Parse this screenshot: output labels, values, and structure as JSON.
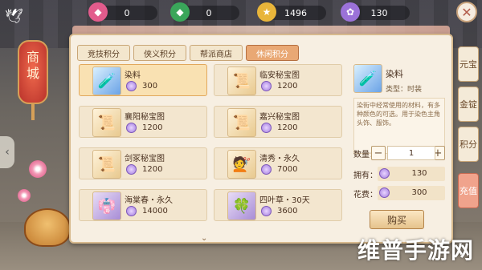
{
  "currencies": [
    {
      "icon": "pink-jade-icon",
      "value": "0",
      "color": "#e25b8c"
    },
    {
      "icon": "green-jade-icon",
      "value": "0",
      "color": "#3aa65a"
    },
    {
      "icon": "gold-coin-icon",
      "value": "1496",
      "color": "#e8b53a"
    },
    {
      "icon": "purple-coin-icon",
      "value": "130",
      "color": "#9b72d8"
    }
  ],
  "side_lantern": {
    "label_top": "商",
    "label_bottom": "城"
  },
  "tabs": [
    {
      "label": "竞技积分",
      "active": false
    },
    {
      "label": "侠义积分",
      "active": false
    },
    {
      "label": "帮派商店",
      "active": false
    },
    {
      "label": "休闲积分",
      "active": true
    }
  ],
  "items": [
    {
      "name": "染料",
      "price": "300",
      "thumb": "dye-bottle-icon",
      "style": "blue",
      "selected": true
    },
    {
      "name": "临安秘宝图",
      "price": "1200",
      "thumb": "treasure-map-icon",
      "style": "gold",
      "selected": false
    },
    {
      "name": "襄阳秘宝图",
      "price": "1200",
      "thumb": "treasure-map-icon",
      "style": "gold",
      "selected": false
    },
    {
      "name": "嘉兴秘宝图",
      "price": "1200",
      "thumb": "treasure-map-icon",
      "style": "gold",
      "selected": false
    },
    {
      "name": "剑冢秘宝图",
      "price": "1200",
      "thumb": "treasure-map-icon",
      "style": "gold",
      "selected": false
    },
    {
      "name": "清秀・永久",
      "price": "7000",
      "thumb": "hairstyle-icon",
      "style": "gold",
      "selected": false
    },
    {
      "name": "海棠春・永久",
      "price": "14000",
      "thumb": "outfit-icon",
      "style": "purple",
      "selected": false
    },
    {
      "name": "四叶草・30天",
      "price": "3600",
      "thumb": "clover-icon",
      "style": "purple",
      "selected": false
    }
  ],
  "detail": {
    "name": "染料",
    "type": "类型：时装",
    "description": "染街中经常使用的材料，有多种颜色的可选。用于染色主角头饰、服饰。",
    "qty_label": "数量：",
    "qty_value": "1",
    "owned_label": "拥有：",
    "owned_value": "130",
    "cost_label": "花费：",
    "cost_value": "300",
    "buy_label": "购买"
  },
  "side_tabs": [
    {
      "label": "元宝"
    },
    {
      "label": "金锭"
    },
    {
      "label": "积分"
    },
    {
      "label": "充值"
    }
  ],
  "watermark": "维普手游网"
}
